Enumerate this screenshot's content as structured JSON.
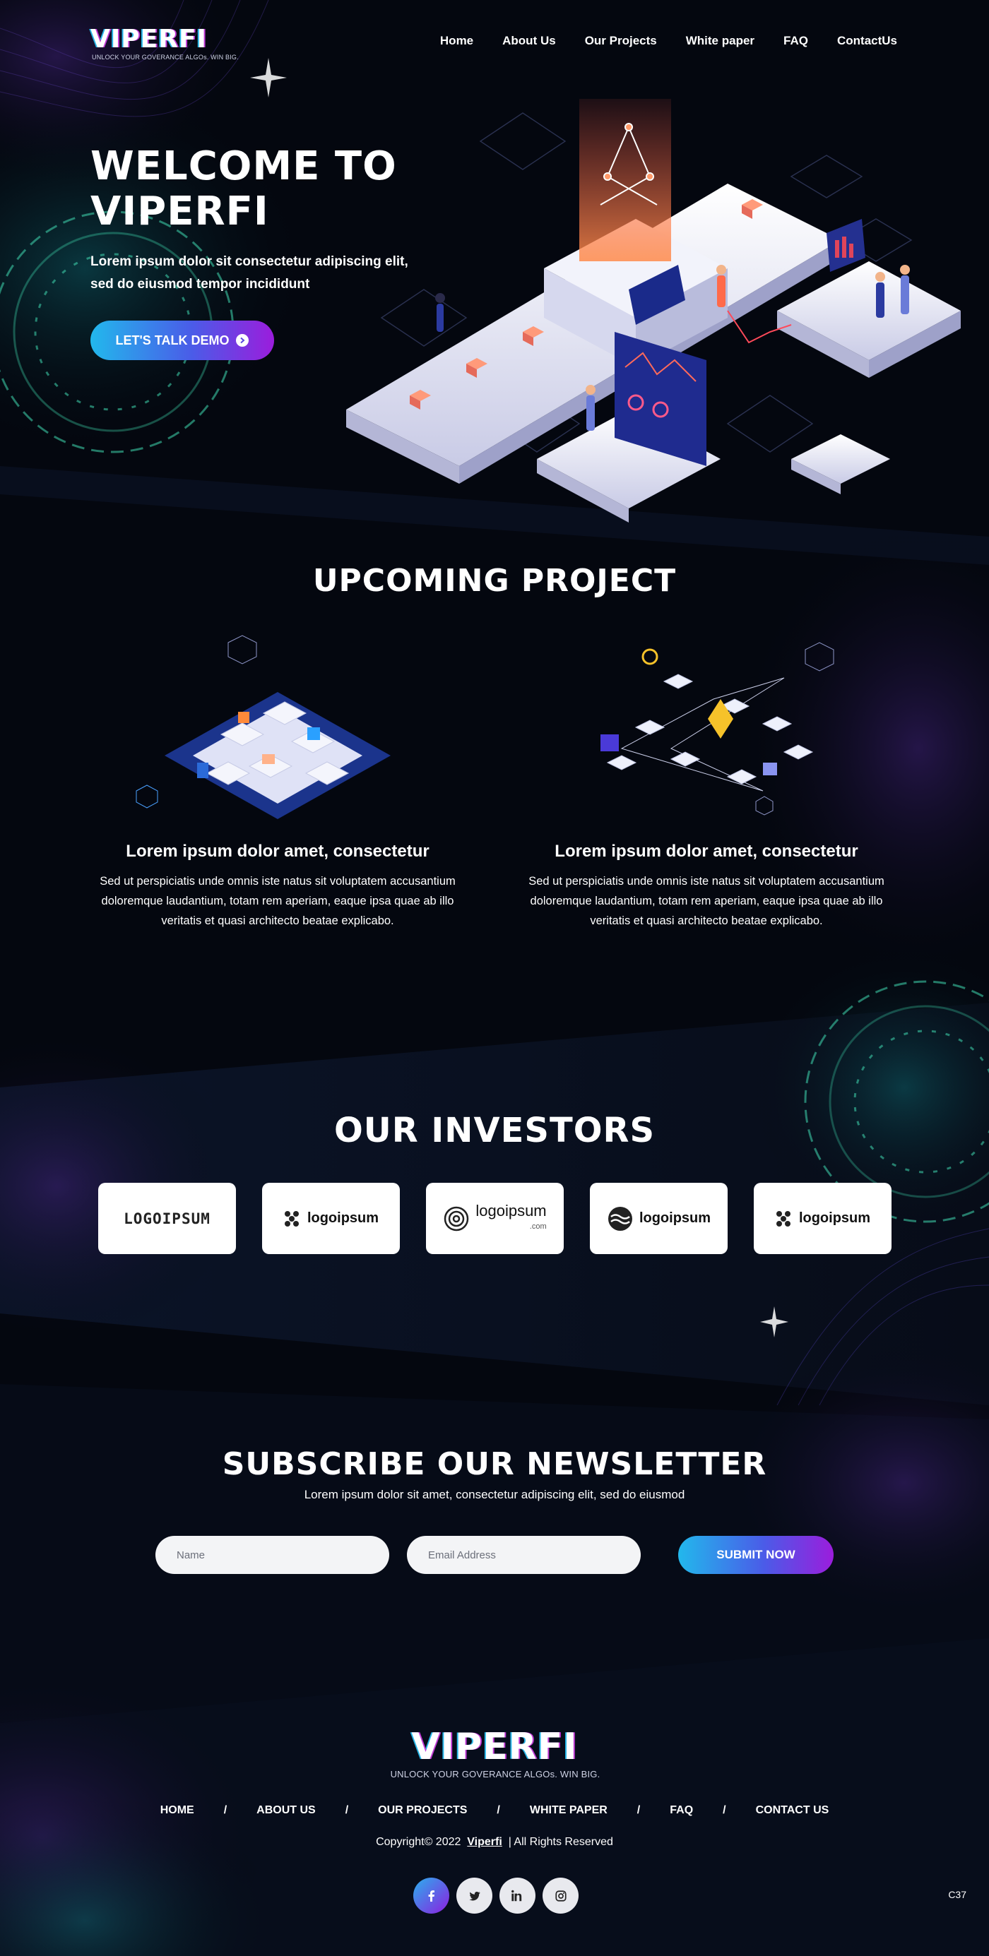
{
  "header": {
    "logo": "VIPERFI",
    "tagline": "UNLOCK YOUR GOVERANCE ALGOs. WIN BIG.",
    "nav": [
      "Home",
      "About Us",
      "Our Projects",
      "White paper",
      "FAQ",
      "ContactUs"
    ]
  },
  "hero": {
    "title_line1": "WELCOME TO",
    "title_line2": "VIPERFI",
    "subtitle": "Lorem ipsum dolor sit  consectetur adipiscing elit, sed do eiusmod tempor incididunt",
    "cta": "LET'S TALK DEMO"
  },
  "projects": {
    "title": "UPCOMING PROJECT",
    "items": [
      {
        "title": "Lorem ipsum dolor amet, consectetur",
        "description": "Sed ut perspiciatis unde omnis iste natus  sit voluptatem accusantium doloremque laudantium, totam rem aperiam, eaque ipsa quae ab illo veritatis et quasi architecto beatae explicabo."
      },
      {
        "title": "Lorem ipsum dolor amet, consectetur",
        "description": "Sed ut perspiciatis unde omnis iste natus  sit voluptatem accusantium doloremque laudantium, totam rem aperiam, eaque ipsa quae ab illo veritatis et quasi architecto beatae explicabo."
      }
    ]
  },
  "investors": {
    "title": "OUR INVESTORS",
    "logos": [
      "LOGOIPSUM",
      "logoipsum",
      "logoipsum",
      "logoipsum",
      "logoipsum"
    ],
    "logo_sub": ".com"
  },
  "newsletter": {
    "title": "SUBSCRIBE OUR NEWSLETTER",
    "subtitle": "Lorem ipsum dolor sit amet, consectetur adipiscing elit, sed do eiusmod",
    "name_placeholder": "Name",
    "email_placeholder": "Email Address",
    "submit": "SUBMIT NOW"
  },
  "footer": {
    "logo": "VIPERFI",
    "tagline": "UNLOCK YOUR GOVERANCE ALGOs. WIN BIG.",
    "nav": [
      "HOME",
      "ABOUT US",
      "OUR PROJECTS",
      "WHITE PAPER",
      "FAQ",
      "CONTACT US"
    ],
    "separator": "/",
    "copyright_prefix": "Copyright© 2022",
    "brand": "Viperfi",
    "copyright_suffix": "|  All Rights Reserved",
    "social": [
      "facebook-icon",
      "twitter-icon",
      "linkedin-icon",
      "instagram-icon"
    ],
    "corner_code": "C37"
  },
  "colors": {
    "background": "#04070f",
    "accent_start": "#22b8ec",
    "accent_end": "#9b1ddc",
    "teal": "#3fd9b0"
  }
}
